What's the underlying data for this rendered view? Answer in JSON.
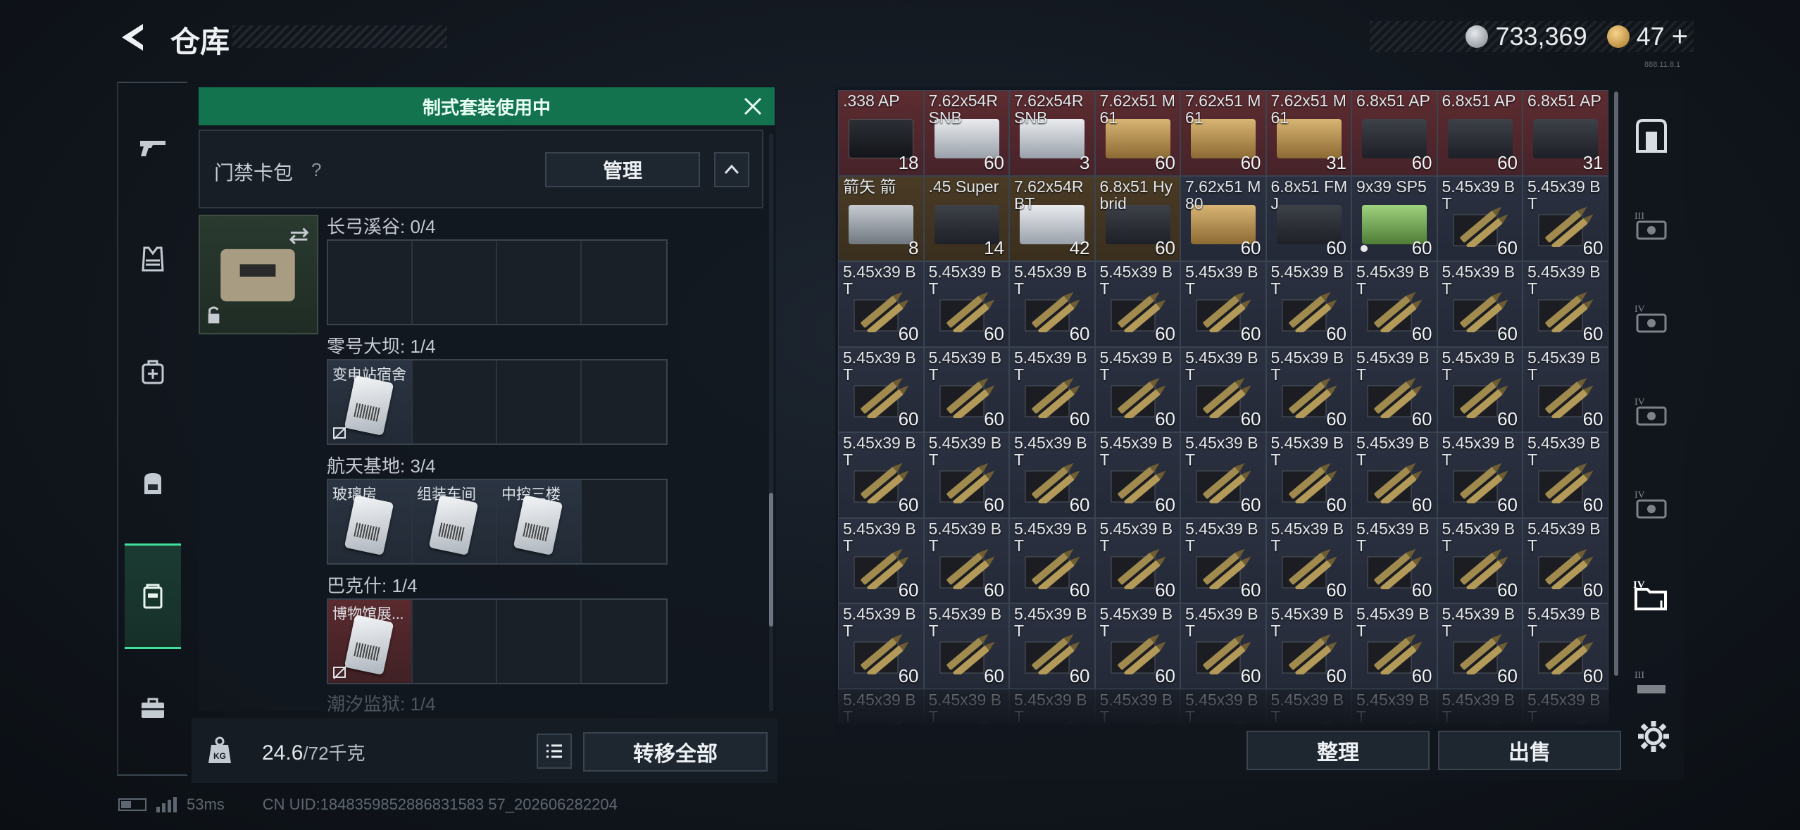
{
  "header": {
    "title": "仓库",
    "currency_silver": "733,369",
    "currency_gold": "47",
    "currency_plus": "+",
    "version": "888.11.8.1"
  },
  "sidebar": {
    "items": [
      {
        "icon": "pistol-icon"
      },
      {
        "icon": "vest-icon"
      },
      {
        "icon": "medkit-bag-icon"
      },
      {
        "icon": "backpack-icon"
      },
      {
        "icon": "keycard-holder-icon",
        "active": true
      },
      {
        "icon": "briefcase-icon"
      }
    ]
  },
  "banner": {
    "text": "制式套装使用中"
  },
  "keycard": {
    "title": "门禁卡包",
    "help": "?",
    "manage_label": "管理",
    "regions": [
      {
        "label": "长弓溪谷: 0/4",
        "slots": []
      },
      {
        "label": "零号大坝: 1/4",
        "slots": [
          {
            "name": "变电站宿舍",
            "color": "blue"
          }
        ]
      },
      {
        "label": "航天基地: 3/4",
        "slots": [
          {
            "name": "玻璃房",
            "color": "blue"
          },
          {
            "name": "组装车间",
            "color": "blue"
          },
          {
            "name": "中控三楼",
            "color": "blue"
          }
        ]
      },
      {
        "label": "巴克什: 1/4",
        "slots": [
          {
            "name": "博物馆展...",
            "color": "red"
          }
        ]
      },
      {
        "label": "潮汐监狱: 1/4",
        "slots": []
      }
    ]
  },
  "weight": {
    "current": "24.6",
    "capacity": "/72千克"
  },
  "actions": {
    "transfer_all": "转移全部",
    "sort": "整理",
    "sell": "出售"
  },
  "status": {
    "ping": "53ms",
    "uid": "CN UID:1848359852886831583 57_202606282204"
  },
  "stash": {
    "cells": [
      {
        "name": ".338 AP",
        "count": "18",
        "bg": "red",
        "img": "box-black"
      },
      {
        "name": "7.62x54R SNB",
        "count": "60",
        "bg": "red",
        "img": "box-white"
      },
      {
        "name": "7.62x54R SNB",
        "count": "3",
        "bg": "red",
        "img": "box-white"
      },
      {
        "name": "7.62x51 M61",
        "count": "60",
        "bg": "red",
        "img": "box-tan"
      },
      {
        "name": "7.62x51 M61",
        "count": "60",
        "bg": "red",
        "img": "box-tan"
      },
      {
        "name": "7.62x51 M61",
        "count": "31",
        "bg": "red",
        "img": "box-tan"
      },
      {
        "name": "6.8x51 AP",
        "count": "60",
        "bg": "red",
        "img": "box-dark"
      },
      {
        "name": "6.8x51 AP",
        "count": "60",
        "bg": "red",
        "img": "box-dark"
      },
      {
        "name": "6.8x51 AP",
        "count": "31",
        "bg": "red",
        "img": "box-dark"
      },
      {
        "name": "箭矢 箭",
        "count": "8",
        "bg": "gold",
        "img": "box-silver"
      },
      {
        "name": ".45 Super",
        "count": "14",
        "bg": "gold",
        "img": "box-dark"
      },
      {
        "name": "7.62x54R BT",
        "count": "42",
        "bg": "gold",
        "img": "box-white"
      },
      {
        "name": "6.8x51 Hybrid",
        "count": "60",
        "bg": "gold",
        "img": "box-dark"
      },
      {
        "name": "7.62x51 M80",
        "count": "60",
        "bg": "blue",
        "img": "box-tan"
      },
      {
        "name": "6.8x51 FMJ",
        "count": "60",
        "bg": "blue",
        "img": "box-dark"
      },
      {
        "name": "9x39 SP5",
        "count": "60",
        "bg": "blue",
        "img": "box-green",
        "dot": true
      },
      {
        "name": "5.45x39 BT",
        "count": "60",
        "bg": "blue",
        "img": "ammo"
      },
      {
        "name": "5.45x39 BT",
        "count": "60",
        "bg": "blue",
        "img": "ammo"
      }
    ],
    "filler": {
      "name": "5.45x39 BT",
      "count": "60",
      "bg": "blue",
      "img": "ammo"
    },
    "filler_count": 54,
    "faded_count": 9
  },
  "right_rail": [
    {
      "icon": "safe-box-icon"
    },
    {
      "icon": "tier3-case-icon"
    },
    {
      "icon": "tier4-case-icon"
    },
    {
      "icon": "tier4-case-icon"
    },
    {
      "icon": "tier4-case-icon"
    },
    {
      "icon": "tier4-folder-icon",
      "active": true
    },
    {
      "icon": "tier3-ammo-icon"
    }
  ]
}
